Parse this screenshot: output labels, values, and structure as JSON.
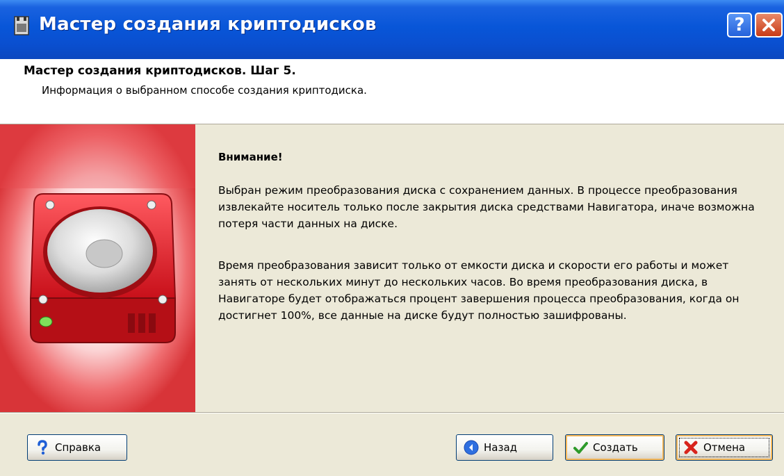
{
  "window": {
    "title": "Мастер создания криптодисков",
    "help_button": "?"
  },
  "header": {
    "title": "Мастер создания криптодисков. Шаг 5.",
    "subtitle": "Информация о выбранном способе создания криптодиска."
  },
  "content": {
    "heading": "Внимание!",
    "paragraph1": "Выбран режим преобразования диска с сохранением данных. В процессе преобразования извлекайте носитель только после закрытия диска средствами Навигатора, иначе возможна потеря части данных на диске.",
    "paragraph2": "Время преобразования зависит только от емкости диска и скорости его работы и может занять от нескольких минут до нескольких часов. Во время преобразования диска, в Навигаторе будет отображаться процент завершения процесса преобразования, когда он достигнет 100%, все данные на диске будут полностью зашифрованы."
  },
  "buttons": {
    "help": "Справка",
    "back": "Назад",
    "create": "Создать",
    "cancel": "Отмена"
  },
  "icons": {
    "app": "app-window-icon",
    "disk": "red-hard-disk-icon",
    "help": "help-question-icon",
    "back": "back-arrow-icon",
    "create": "green-check-icon",
    "cancel": "red-x-icon"
  },
  "colors": {
    "titlebar": "#0856d8",
    "face": "#ece9d8",
    "disk": "#d8161c"
  }
}
